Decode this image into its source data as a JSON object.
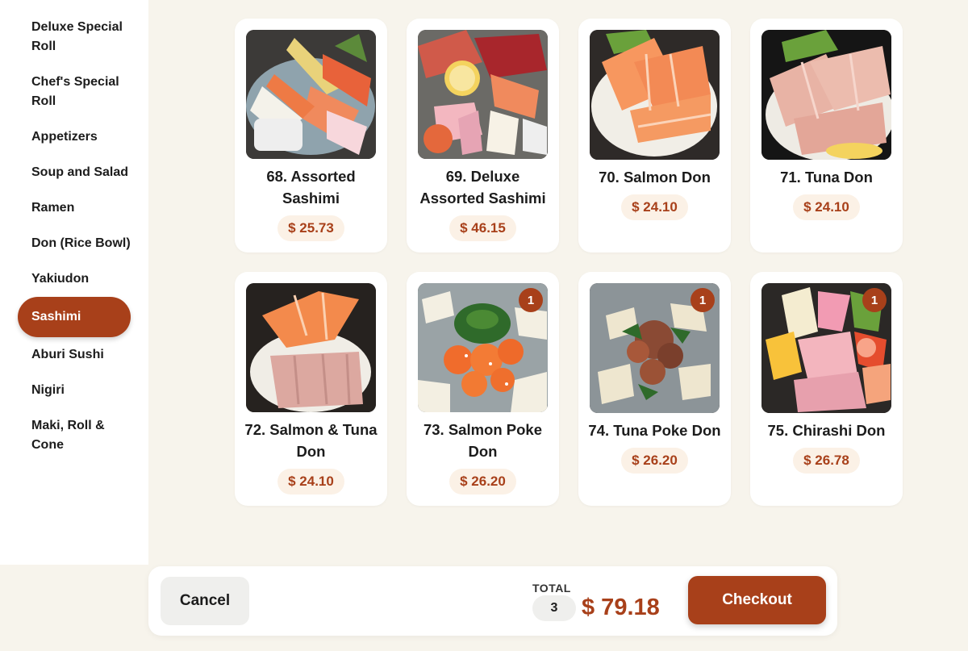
{
  "sidebar": {
    "categories": [
      {
        "label": "Deluxe Special Roll",
        "active": false
      },
      {
        "label": "Chef's Special Roll",
        "active": false
      },
      {
        "label": "Appetizers",
        "active": false
      },
      {
        "label": "Soup and Salad",
        "active": false
      },
      {
        "label": "Ramen",
        "active": false
      },
      {
        "label": "Don (Rice Bowl)",
        "active": false
      },
      {
        "label": "Yakiudon",
        "active": false
      },
      {
        "label": "Sashimi",
        "active": true
      },
      {
        "label": "Aburi Sushi",
        "active": false
      },
      {
        "label": "Nigiri",
        "active": false
      },
      {
        "label": "Maki, Roll & Cone",
        "active": false
      }
    ]
  },
  "items": [
    {
      "name": "68. Assorted Sashimi",
      "price": "$ 25.73",
      "qty": "",
      "photo": "assorted-sashimi"
    },
    {
      "name": "69. Deluxe Assorted Sashimi",
      "price": "$ 46.15",
      "qty": "",
      "photo": "deluxe-sashimi"
    },
    {
      "name": "70. Salmon Don",
      "price": "$ 24.10",
      "qty": "",
      "photo": "salmon-don"
    },
    {
      "name": "71. Tuna Don",
      "price": "$ 24.10",
      "qty": "",
      "photo": "tuna-don"
    },
    {
      "name": "72. Salmon & Tuna Don",
      "price": "$ 24.10",
      "qty": "",
      "photo": "salmon-tuna-don"
    },
    {
      "name": "73. Salmon Poke Don",
      "price": "$ 26.20",
      "qty": "1",
      "photo": "salmon-poke"
    },
    {
      "name": "74. Tuna Poke Don",
      "price": "$ 26.20",
      "qty": "1",
      "photo": "tuna-poke"
    },
    {
      "name": "75. Chirashi Don",
      "price": "$ 26.78",
      "qty": "1",
      "photo": "chirashi"
    }
  ],
  "footer": {
    "cancel_label": "Cancel",
    "total_label": "TOTAL",
    "item_count": "3",
    "total_amount": "$ 79.18",
    "checkout_label": "Checkout"
  },
  "colors": {
    "accent": "#a8401a",
    "price_bg": "#fbf1e6",
    "background": "#f7f4ec"
  }
}
